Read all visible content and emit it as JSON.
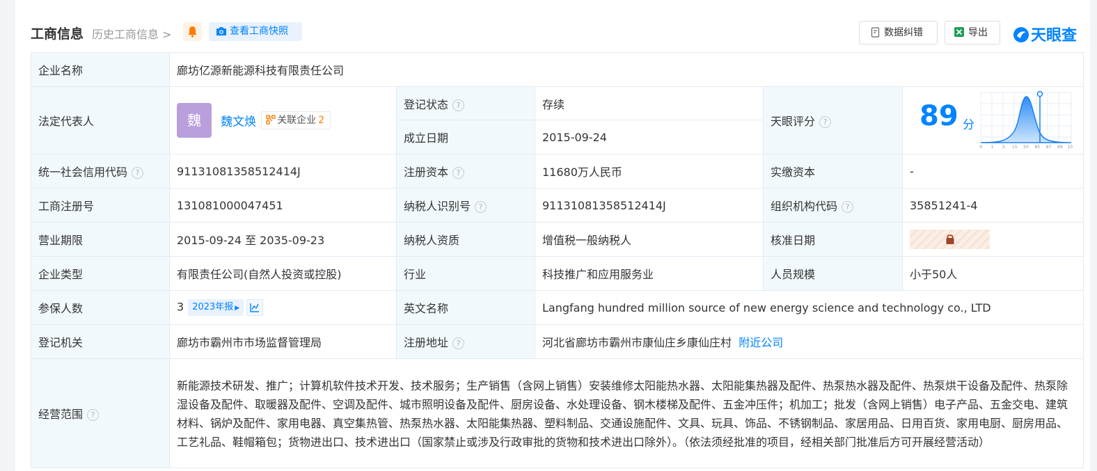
{
  "header": {
    "title": "工商信息",
    "history_link": "历史工商信息",
    "snapshot_button": "查看工商快照",
    "error_button": "数据纠错",
    "export_button": "导出",
    "logo_text": "天眼查"
  },
  "colors": {
    "accent": "#0084ff",
    "label_bg": "#f2f9fc",
    "status_green": "#27a64b",
    "border": "#e4eaf3",
    "avatar_bg": "#b99fdc"
  },
  "icons": {
    "bell": "bell-icon",
    "camera": "camera-icon",
    "error": "document-edit-icon",
    "export": "excel-icon",
    "logo": "tianyancha-logo-icon",
    "related": "network-icon",
    "trend": "line-chart-icon",
    "lock": "lock-icon",
    "help": "question-icon"
  },
  "labels": {
    "company_name": "企业名称",
    "legal_rep": "法定代表人",
    "reg_status": "登记状态",
    "found_date": "成立日期",
    "tianyan_score": "天眼评分",
    "credit_code": "统一社会信用代码",
    "reg_capital": "注册资本",
    "paid_capital": "实缴资本",
    "reg_no": "工商注册号",
    "taxpayer_id": "纳税人识别号",
    "org_code": "组织机构代码",
    "biz_term": "营业期限",
    "taxpayer_qual": "纳税人资质",
    "approval_date": "核准日期",
    "company_type": "企业类型",
    "industry": "行业",
    "staff_size": "人员规模",
    "insured": "参保人数",
    "english_name": "英文名称",
    "reg_authority": "登记机关",
    "reg_address": "注册地址",
    "biz_scope": "经营范围"
  },
  "values": {
    "company_name": "廊坊亿源新能源科技有限责任公司",
    "avatar_char": "魏",
    "legal_rep_name": "魏文焕",
    "related_label": "关联企业",
    "related_count": "2",
    "reg_status": "存续",
    "found_date": "2015-09-24",
    "score": "89",
    "score_unit": "分",
    "credit_code": "91131081358512414J",
    "reg_capital": "11680万人民币",
    "paid_capital": "-",
    "reg_no": "131081000047451",
    "taxpayer_id": "91131081358512414J",
    "org_code": "35851241-4",
    "biz_term": "2015-09-24 至 2035-09-23",
    "taxpayer_qual": "增值税一般纳税人",
    "company_type": "有限责任公司(自然人投资或控股)",
    "industry": "科技推广和应用服务业",
    "staff_size": "小于50人",
    "insured": "3",
    "annual_report": "2023年报",
    "english_name": "Langfang hundred million source of new energy science and technology co., LTD",
    "reg_authority": "廊坊市霸州市市场监督管理局",
    "reg_address": "河北省廊坊市霸州市康仙庄乡康仙庄村",
    "nearby_link": "附近公司",
    "biz_scope": "新能源技术研发、推广；计算机软件技术开发、技术服务；生产销售（含网上销售）安装维修太阳能热水器、太阳能集热器及配件、热泵热水器及配件、热泵烘干设备及配件、热泵除湿设备及配件、取暖器及配件、空调及配件、城市照明设备及配件、厨房设备、水处理设备、钢木楼梯及配件、五金冲压件；机加工；批发（含网上销售）电子产品、五金交电、建筑材料、锅炉及配件、家用电器、真空集热管、热泵热水器、太阳能集热器、塑料制品、交通设施配件、文具、玩具、饰品、不锈钢制品、家居用品、日用百货、家用电厨、厨房用品、工艺礼品、鞋帽箱包；货物进出口、技术进出口（国家禁止或涉及行政审批的货物和技术进出口除外）。（依法须经批准的项目，经相关部门批准后方可开展经营活动）"
  },
  "score_chart": {
    "ticks": [
      "0",
      "1",
      "3",
      "15",
      "50",
      "85",
      "97",
      "99",
      "100"
    ],
    "marker_value": 89
  }
}
